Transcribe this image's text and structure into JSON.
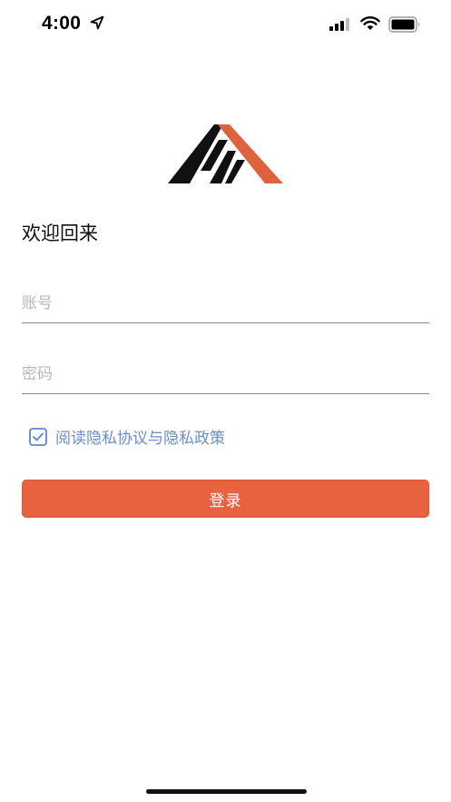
{
  "status_bar": {
    "time": "4:00",
    "icons": [
      "location-arrow-icon",
      "cellular-signal-icon",
      "wifi-icon",
      "battery-icon"
    ]
  },
  "logo": {
    "icon": "house-roof-logo",
    "colors": {
      "dark": "#111111",
      "accent": "#e0613e"
    }
  },
  "login": {
    "title": "欢迎回来",
    "account_placeholder": "账号",
    "account_value": "",
    "password_placeholder": "密码",
    "password_value": "",
    "agreement_text": "阅读隐私协议与隐私政策",
    "agreement_checked": true,
    "submit_label": "登录"
  },
  "colors": {
    "primary": "#e8623f",
    "link": "#6b8ec9",
    "placeholder": "#b8b8b8",
    "divider": "#8a8a8a"
  }
}
